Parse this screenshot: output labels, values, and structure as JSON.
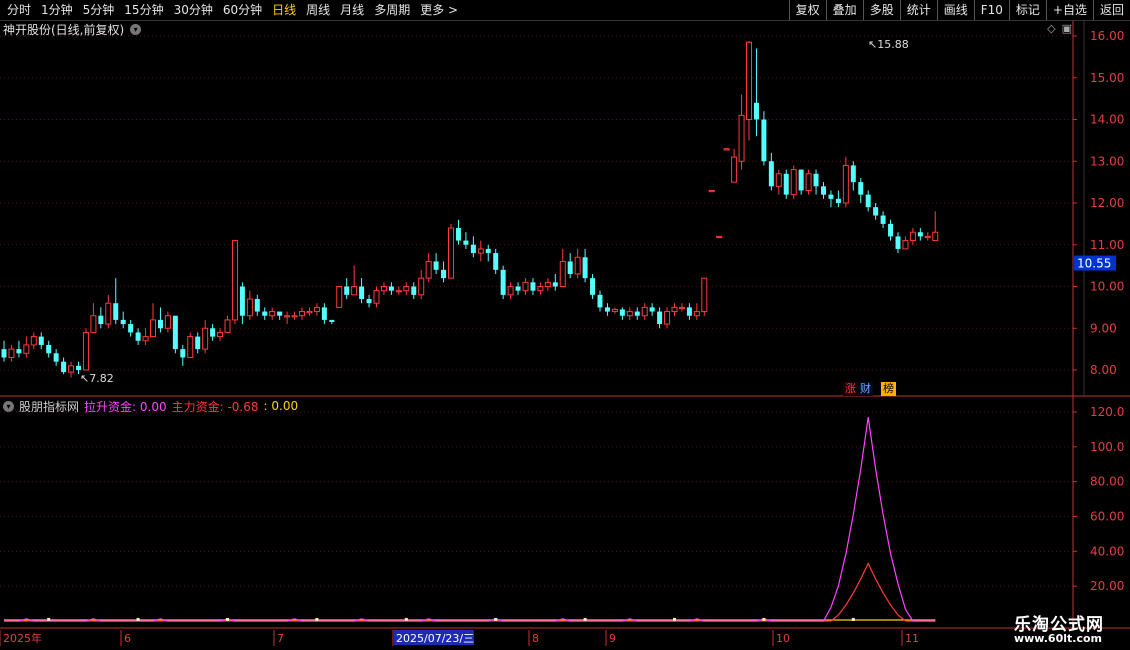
{
  "toolbar": {
    "periods": [
      "分时",
      "1分钟",
      "5分钟",
      "15分钟",
      "30分钟",
      "60分钟",
      "日线",
      "周线",
      "月线",
      "多周期",
      "更多 >"
    ],
    "active_period": "日线",
    "actions": [
      "复权",
      "叠加",
      "多股",
      "统计",
      "画线",
      "F10",
      "标记",
      "+自选",
      "返回"
    ]
  },
  "stock": {
    "title": "神开股份(日线,前复权)"
  },
  "indicator": {
    "name": "股朋指标网",
    "lift_label": "拉升资金: 0.00",
    "main_label": "主力资金: -0.68",
    "third_label": ": 0.00"
  },
  "price_axis": {
    "ticks": [
      "16.00",
      "15.00",
      "14.00",
      "13.00",
      "12.00",
      "11.00",
      "10.00",
      "9.00",
      "8.00"
    ],
    "current": "10.55"
  },
  "indicator_axis": {
    "ticks": [
      "120.0",
      "100.0",
      "80.00",
      "60.00",
      "40.00",
      "20.00"
    ]
  },
  "annotations": {
    "high": "15.88",
    "low": "7.82"
  },
  "date_axis": {
    "labels": [
      "2025年",
      "6",
      "7",
      "2025/07/23/三",
      "8",
      "9",
      "10",
      "11"
    ]
  },
  "badges": {
    "b1": "涨",
    "b2": "财",
    "b3": "榜"
  },
  "watermark": {
    "name": "乐淘公式网",
    "url": "www.60lt.com"
  },
  "colors": {
    "up": "#ff3b3b",
    "down": "#54ffff",
    "axis": "#c83232",
    "lift": "#ff44ff",
    "main": "#ff3b3b",
    "third": "#ffd400"
  },
  "chart_data": {
    "type": "candlestick",
    "y_axis_price": [
      8.0,
      16.0
    ],
    "y_axis_indicator": [
      0,
      120
    ],
    "candles": [
      [
        8.5,
        8.3,
        8.7,
        8.2
      ],
      [
        8.3,
        8.5,
        8.6,
        8.2
      ],
      [
        8.5,
        8.4,
        8.7,
        8.3
      ],
      [
        8.4,
        8.6,
        8.8,
        8.3
      ],
      [
        8.6,
        8.8,
        8.9,
        8.5
      ],
      [
        8.8,
        8.6,
        8.9,
        8.5
      ],
      [
        8.6,
        8.4,
        8.7,
        8.3
      ],
      [
        8.4,
        8.2,
        8.5,
        8.1
      ],
      [
        8.2,
        7.95,
        8.3,
        7.9
      ],
      [
        7.95,
        8.1,
        8.2,
        7.82
      ],
      [
        8.1,
        8.0,
        8.2,
        7.9
      ],
      [
        8.0,
        8.9,
        9.0,
        8.0
      ],
      [
        8.9,
        9.3,
        9.6,
        8.9
      ],
      [
        9.3,
        9.1,
        9.5,
        9.0
      ],
      [
        9.1,
        9.6,
        9.8,
        9.0
      ],
      [
        9.6,
        9.2,
        10.2,
        9.1
      ],
      [
        9.2,
        9.1,
        9.4,
        9.0
      ],
      [
        9.1,
        8.9,
        9.2,
        8.8
      ],
      [
        8.9,
        8.7,
        9.0,
        8.6
      ],
      [
        8.7,
        8.8,
        9.0,
        8.6
      ],
      [
        8.8,
        9.2,
        9.6,
        8.8
      ],
      [
        9.2,
        9.0,
        9.5,
        8.9
      ],
      [
        9.0,
        9.3,
        9.4,
        8.9
      ],
      [
        9.3,
        8.5,
        9.3,
        8.4
      ],
      [
        8.5,
        8.3,
        8.6,
        8.1
      ],
      [
        8.3,
        8.8,
        8.9,
        8.3
      ],
      [
        8.8,
        8.5,
        8.9,
        8.4
      ],
      [
        8.5,
        9.0,
        9.2,
        8.4
      ],
      [
        9.0,
        8.8,
        9.1,
        8.7
      ],
      [
        8.8,
        8.9,
        9.0,
        8.7
      ],
      [
        8.9,
        9.2,
        9.3,
        8.9
      ],
      [
        9.2,
        11.1,
        11.1,
        9.1
      ],
      [
        10.0,
        9.3,
        10.1,
        9.1
      ],
      [
        9.3,
        9.7,
        9.9,
        9.2
      ],
      [
        9.7,
        9.4,
        9.8,
        9.3
      ],
      [
        9.4,
        9.3,
        9.5,
        9.2
      ],
      [
        9.3,
        9.4,
        9.5,
        9.2
      ],
      [
        9.4,
        9.3,
        9.4,
        9.2
      ],
      [
        9.3,
        9.3,
        9.4,
        9.1
      ],
      [
        9.3,
        9.3,
        9.4,
        9.2
      ],
      [
        9.3,
        9.4,
        9.5,
        9.2
      ],
      [
        9.4,
        9.4,
        9.5,
        9.3
      ],
      [
        9.4,
        9.5,
        9.6,
        9.3
      ],
      [
        9.5,
        9.2,
        9.6,
        9.1
      ],
      [
        9.2,
        9.15,
        9.2,
        9.1
      ],
      [
        9.5,
        10.0,
        10.0,
        9.5
      ],
      [
        10.0,
        9.8,
        10.2,
        9.7
      ],
      [
        9.8,
        10.0,
        10.5,
        9.8
      ],
      [
        10.0,
        9.7,
        10.2,
        9.6
      ],
      [
        9.7,
        9.6,
        9.8,
        9.5
      ],
      [
        9.6,
        9.9,
        10.0,
        9.5
      ],
      [
        9.9,
        10.0,
        10.1,
        9.8
      ],
      [
        10.0,
        9.9,
        10.1,
        9.8
      ],
      [
        9.9,
        9.9,
        10.0,
        9.8
      ],
      [
        9.9,
        10.0,
        10.1,
        9.8
      ],
      [
        10.0,
        9.8,
        10.1,
        9.7
      ],
      [
        9.8,
        10.2,
        10.4,
        9.7
      ],
      [
        10.2,
        10.6,
        10.8,
        10.1
      ],
      [
        10.6,
        10.4,
        10.8,
        10.3
      ],
      [
        10.4,
        10.2,
        10.6,
        10.1
      ],
      [
        10.2,
        11.4,
        11.5,
        10.2
      ],
      [
        11.4,
        11.1,
        11.6,
        11.0
      ],
      [
        11.1,
        11.0,
        11.3,
        10.9
      ],
      [
        11.0,
        10.8,
        11.2,
        10.7
      ],
      [
        10.8,
        10.9,
        11.1,
        10.6
      ],
      [
        10.9,
        10.8,
        11.0,
        10.6
      ],
      [
        10.8,
        10.4,
        10.9,
        10.3
      ],
      [
        10.4,
        9.8,
        10.5,
        9.7
      ],
      [
        9.8,
        10.0,
        10.1,
        9.7
      ],
      [
        10.0,
        9.9,
        10.1,
        9.8
      ],
      [
        9.9,
        10.1,
        10.2,
        9.8
      ],
      [
        10.1,
        9.9,
        10.2,
        9.8
      ],
      [
        9.9,
        10.0,
        10.1,
        9.8
      ],
      [
        10.0,
        10.1,
        10.2,
        9.9
      ],
      [
        10.1,
        10.0,
        10.3,
        9.9
      ],
      [
        10.0,
        10.6,
        10.9,
        10.0
      ],
      [
        10.6,
        10.3,
        10.8,
        10.2
      ],
      [
        10.3,
        10.7,
        10.9,
        10.2
      ],
      [
        10.7,
        10.2,
        10.9,
        10.1
      ],
      [
        10.2,
        9.8,
        10.3,
        9.7
      ],
      [
        9.8,
        9.5,
        9.9,
        9.4
      ],
      [
        9.5,
        9.4,
        9.6,
        9.3
      ],
      [
        9.4,
        9.45,
        9.5,
        9.35
      ],
      [
        9.45,
        9.3,
        9.5,
        9.2
      ],
      [
        9.3,
        9.4,
        9.5,
        9.2
      ],
      [
        9.4,
        9.3,
        9.5,
        9.2
      ],
      [
        9.3,
        9.5,
        9.6,
        9.2
      ],
      [
        9.5,
        9.4,
        9.6,
        9.3
      ],
      [
        9.4,
        9.1,
        9.5,
        9.0
      ],
      [
        9.1,
        9.4,
        9.5,
        9.0
      ],
      [
        9.4,
        9.5,
        9.6,
        9.3
      ],
      [
        9.5,
        9.5,
        9.6,
        9.4
      ],
      [
        9.5,
        9.3,
        9.6,
        9.2
      ],
      [
        9.3,
        9.4,
        9.6,
        9.2
      ],
      [
        9.4,
        10.2,
        10.2,
        9.3
      ],
      [
        12.3,
        12.3,
        12.3,
        12.3
      ],
      [
        11.2,
        11.2,
        11.2,
        11.2
      ],
      [
        13.3,
        13.3,
        13.3,
        13.3
      ],
      [
        12.5,
        13.1,
        13.3,
        12.7
      ],
      [
        13.0,
        14.1,
        14.6,
        12.8
      ],
      [
        14.0,
        15.85,
        15.88,
        13.5
      ],
      [
        14.4,
        14.0,
        15.7,
        13.6
      ],
      [
        14.0,
        13.0,
        14.2,
        12.9
      ],
      [
        13.0,
        12.4,
        13.2,
        12.3
      ],
      [
        12.4,
        12.7,
        12.8,
        12.2
      ],
      [
        12.7,
        12.2,
        12.8,
        12.1
      ],
      [
        12.2,
        12.8,
        12.9,
        12.1
      ],
      [
        12.8,
        12.3,
        12.8,
        12.2
      ],
      [
        12.3,
        12.7,
        12.8,
        12.2
      ],
      [
        12.7,
        12.4,
        12.8,
        12.2
      ],
      [
        12.4,
        12.2,
        12.5,
        12.1
      ],
      [
        12.2,
        12.1,
        12.3,
        11.9
      ],
      [
        12.1,
        12.0,
        12.3,
        11.9
      ],
      [
        12.0,
        12.9,
        13.1,
        11.9
      ],
      [
        12.9,
        12.5,
        13.0,
        12.3
      ],
      [
        12.5,
        12.2,
        12.6,
        12.0
      ],
      [
        12.2,
        11.9,
        12.3,
        11.8
      ],
      [
        11.9,
        11.7,
        12.0,
        11.6
      ],
      [
        11.7,
        11.5,
        11.8,
        11.4
      ],
      [
        11.5,
        11.2,
        11.6,
        11.1
      ],
      [
        11.2,
        10.9,
        11.3,
        10.8
      ],
      [
        10.9,
        11.1,
        11.2,
        10.9
      ],
      [
        11.1,
        11.3,
        11.4,
        11.0
      ],
      [
        11.3,
        11.2,
        11.4,
        11.1
      ],
      [
        11.2,
        11.2,
        11.3,
        11.1
      ],
      [
        11.1,
        11.3,
        11.8,
        11.1
      ]
    ],
    "lift_series_peak": 117,
    "main_series_peak": 33
  }
}
